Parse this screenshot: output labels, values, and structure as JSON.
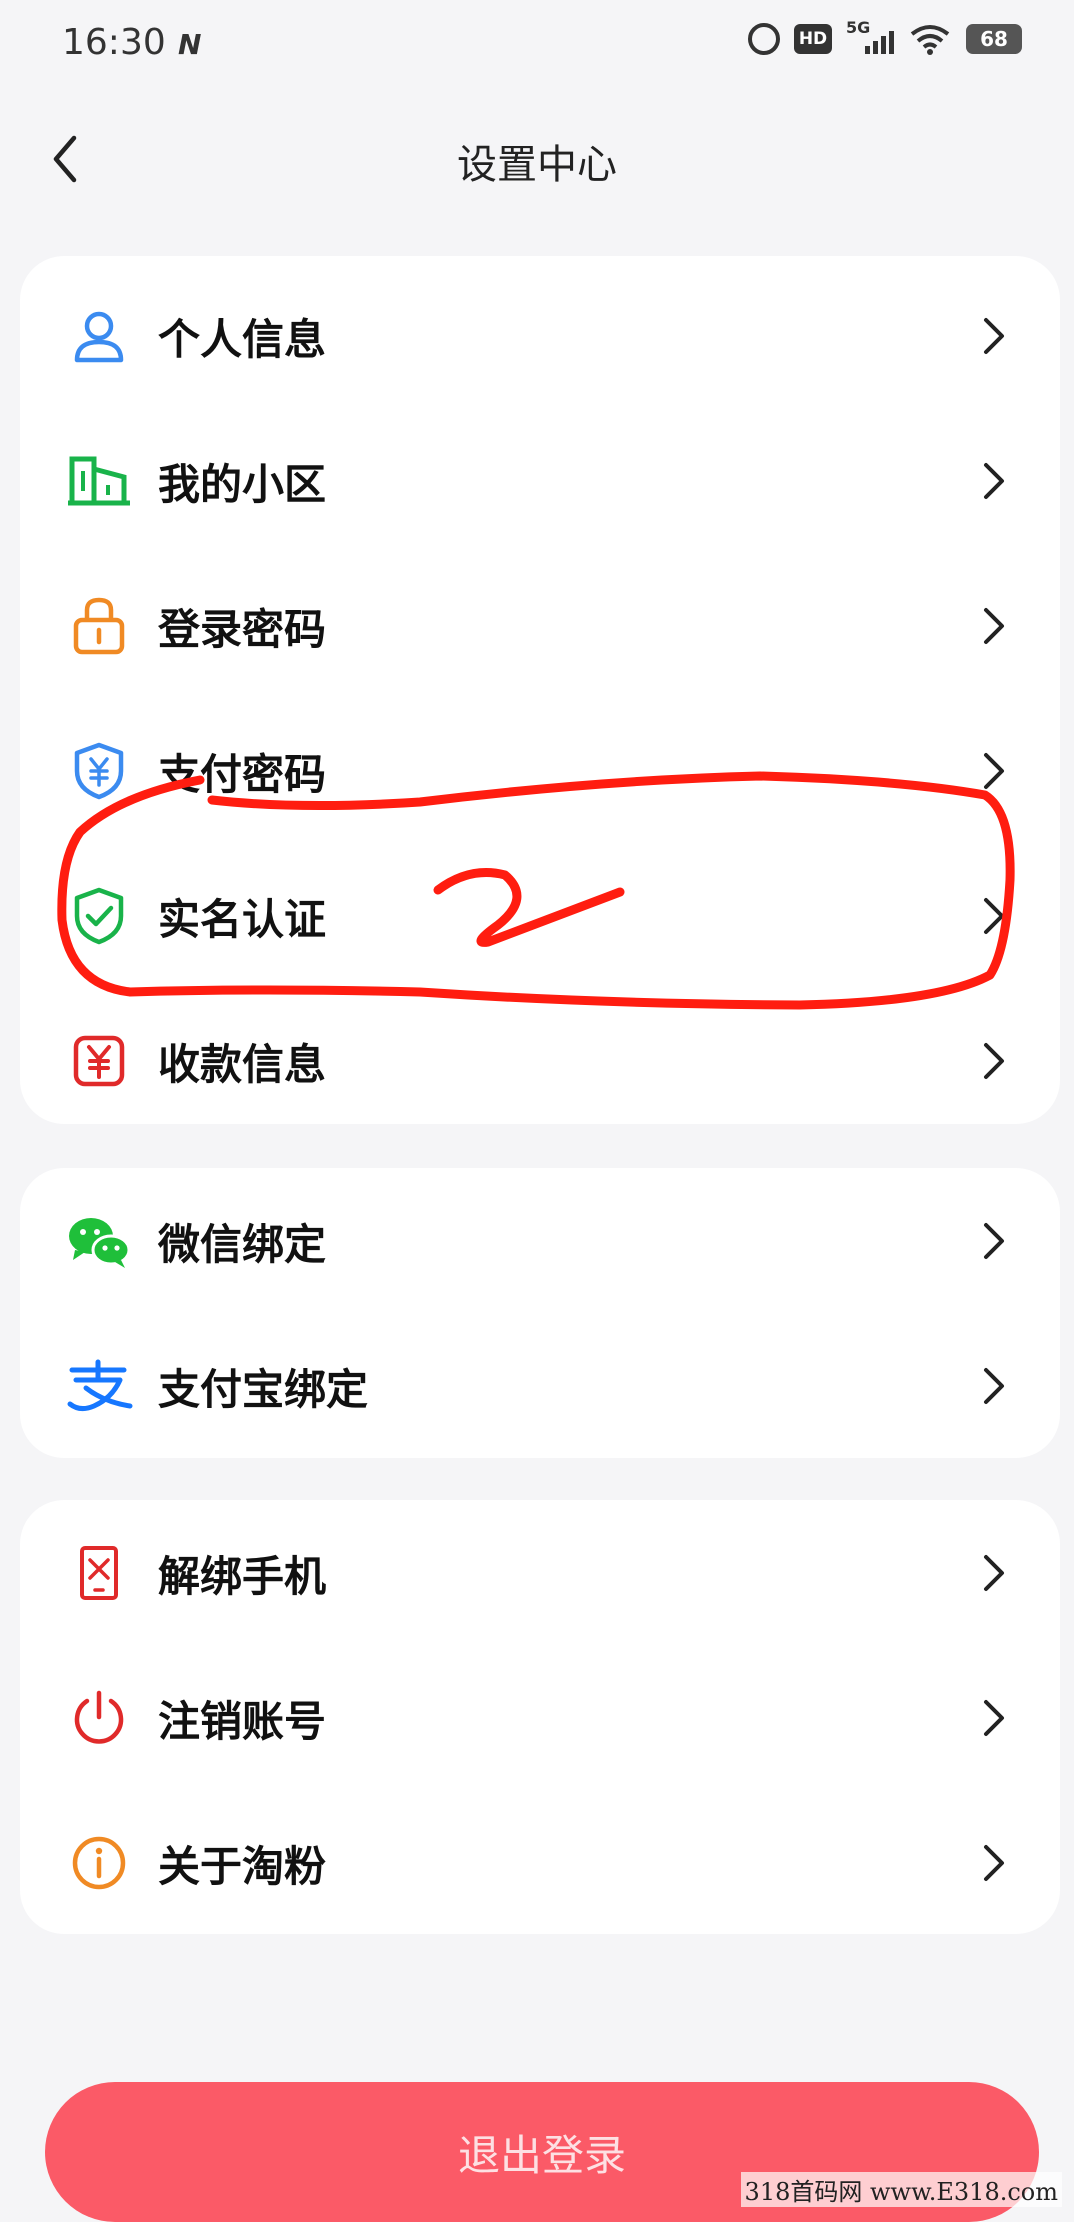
{
  "status": {
    "time": "16:30",
    "network": "5G",
    "hd": "HD",
    "battery": "68"
  },
  "nav": {
    "title": "设置中心"
  },
  "groups": [
    {
      "items": [
        {
          "label": "个人信息",
          "icon": "person-icon",
          "color": "#3b8bf0"
        },
        {
          "label": "我的小区",
          "icon": "building-icon",
          "color": "#19b34a"
        },
        {
          "label": "登录密码",
          "icon": "lock-icon",
          "color": "#f08a24"
        },
        {
          "label": "支付密码",
          "icon": "payment-shield-icon",
          "color": "#3b8bf0"
        },
        {
          "label": "实名认证",
          "icon": "verified-shield-icon",
          "color": "#19b34a"
        },
        {
          "label": "收款信息",
          "icon": "yuan-receipt-icon",
          "color": "#e02a2a"
        }
      ]
    },
    {
      "items": [
        {
          "label": "微信绑定",
          "icon": "wechat-icon",
          "color": "#1fbf3a"
        },
        {
          "label": "支付宝绑定",
          "icon": "alipay-icon",
          "color": "#1677ff"
        }
      ]
    },
    {
      "items": [
        {
          "label": "解绑手机",
          "icon": "phone-unbind-icon",
          "color": "#e02a2a"
        },
        {
          "label": "注销账号",
          "icon": "power-icon",
          "color": "#e02a2a"
        },
        {
          "label": "关于淘粉",
          "icon": "info-icon",
          "color": "#f08a24"
        }
      ]
    }
  ],
  "logout": {
    "label": "退出登录"
  },
  "annotation": {
    "text": "2",
    "color": "#ff1d10"
  },
  "watermark": "318首码网  www.E318.com"
}
